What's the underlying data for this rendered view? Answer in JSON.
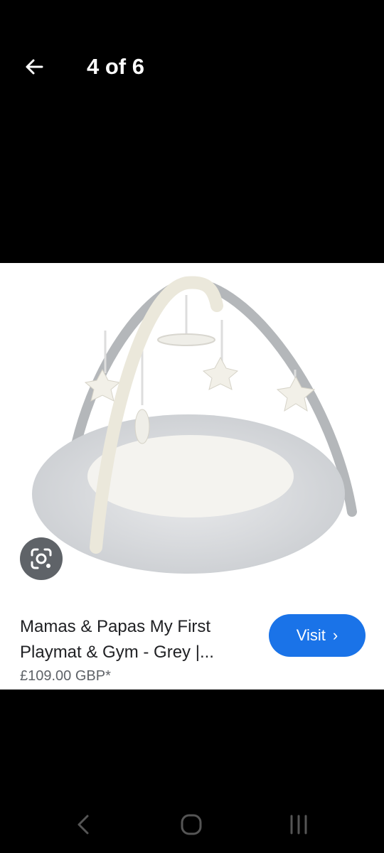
{
  "header": {
    "back_icon": "arrow-left-icon",
    "counter": "4 of 6"
  },
  "image": {
    "alt": "Mamas & Papas My First Playmat & Gym - Grey"
  },
  "lens": {
    "icon": "google-lens-icon"
  },
  "product": {
    "title": "Mamas & Papas My First Playmat & Gym - Grey |...",
    "price": "£109.00 GBP*",
    "visit_label": "Visit",
    "visit_icon": "chevron-right-icon",
    "accent_color": "#1a73e8"
  },
  "system_nav": {
    "back_icon": "nav-back-icon",
    "home_icon": "nav-home-icon",
    "recents_icon": "nav-recents-icon"
  }
}
